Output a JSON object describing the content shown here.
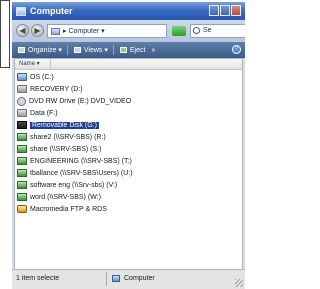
{
  "window": {
    "title": "Computer"
  },
  "address_bar": {
    "location": "▸ Computer ▾",
    "search_placeholder": "Se"
  },
  "toolbar": {
    "organize": "Organize ▾",
    "views": "Views ▾",
    "eject": "Eject",
    "more": "»",
    "help_icon": "help-icon"
  },
  "column_header": {
    "name": "Name ▾"
  },
  "items": [
    {
      "label": "OS (C:)",
      "icon": "hard-drive-icon",
      "selected": false
    },
    {
      "label": "RECOVERY (D:)",
      "icon": "hard-drive-icon",
      "selected": false
    },
    {
      "label": "DVD RW Drive (E:) DVD_VIDEO",
      "icon": "dvd-drive-icon",
      "selected": false
    },
    {
      "label": "Data (F:)",
      "icon": "hard-drive-icon",
      "selected": false
    },
    {
      "label": "Removable Disk (G:)",
      "icon": "removable-disk-icon",
      "selected": true
    },
    {
      "label": "share2 (\\\\SRV-SBS) (R:)",
      "icon": "network-drive-icon",
      "selected": false
    },
    {
      "label": "share (\\\\SRV-SBS) (S:)",
      "icon": "network-drive-icon",
      "selected": false
    },
    {
      "label": "ENGINEERING (\\\\SRV-SBS) (T:)",
      "icon": "network-drive-icon",
      "selected": false
    },
    {
      "label": "tballance (\\\\SRV-SBS\\Users) (U:)",
      "icon": "network-drive-icon",
      "selected": false
    },
    {
      "label": "software eng (\\\\Srv-sbs) (V:)",
      "icon": "network-drive-icon",
      "selected": false
    },
    {
      "label": "word (\\\\SRV-SBS) (W:)",
      "icon": "network-drive-icon",
      "selected": false
    },
    {
      "label": "Macromedia FTP & RDS",
      "icon": "ftp-folder-icon",
      "selected": false
    }
  ],
  "status_bar": {
    "selection": "1 item selecte",
    "location": "Computer"
  },
  "colors": {
    "title_bar": "#2855a8",
    "selection": "#1f3e8c",
    "window_bg": "#d9dce4"
  }
}
